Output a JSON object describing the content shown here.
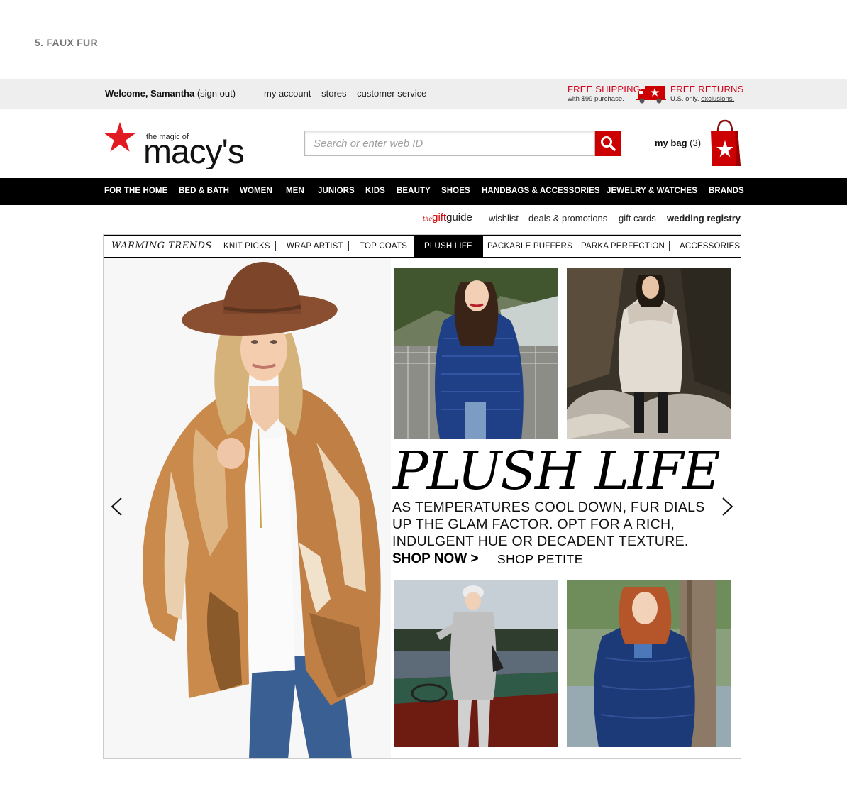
{
  "slide_label": "5. FAUX FUR",
  "topbar": {
    "welcome_prefix": "Welcome, Samantha",
    "sign_out": "(sign out)",
    "links": [
      "my account",
      "stores",
      "customer service"
    ],
    "free_shipping_title": "FREE SHIPPING",
    "free_shipping_sub": "with $99 purchase.",
    "free_returns_title": "FREE RETURNS",
    "free_returns_sub_prefix": "U.S. only.",
    "free_returns_link": "exclusions."
  },
  "header": {
    "logo_tagline": "the magic of",
    "logo_text": "macy's",
    "search_placeholder": "Search or enter web ID",
    "bag_label": "my bag",
    "bag_count": "(3)"
  },
  "nav": {
    "items": [
      "FOR THE HOME",
      "BED & BATH",
      "WOMEN",
      "MEN",
      "JUNIORS",
      "KIDS",
      "BEAUTY",
      "SHOES",
      "HANDBAGS & ACCESSORIES",
      "JEWELRY & WATCHES",
      "BRANDS"
    ]
  },
  "sublinks": {
    "gift_the": "the",
    "gift_gift": "gift",
    "gift_guide": "guide",
    "wishlist": "wishlist",
    "deals": "deals & promotions",
    "gift_cards": "gift cards",
    "registry": "wedding registry"
  },
  "tabs": {
    "lead": "WARMING TRENDS",
    "items": [
      "KNIT PICKS",
      "WRAP ARTIST",
      "TOP COATS",
      "PLUSH LIFE",
      "PACKABLE PUFFERS",
      "PARKA PERFECTION",
      "ACCESSORIES"
    ],
    "active": "PLUSH LIFE"
  },
  "feature": {
    "headline": "PLUSH LIFE",
    "body": "AS TEMPERATURES COOL DOWN, FUR DIALS UP THE GLAM FACTOR. OPT FOR A RICH, INDULGENT HUE OR DECADENT TEXTURE.",
    "shop_now": "SHOP NOW >",
    "shop_petite": "SHOP PETITE"
  },
  "colors": {
    "brand_red": "#cc0000",
    "nav_bg": "#000000",
    "topbar_bg": "#eeeeee"
  }
}
